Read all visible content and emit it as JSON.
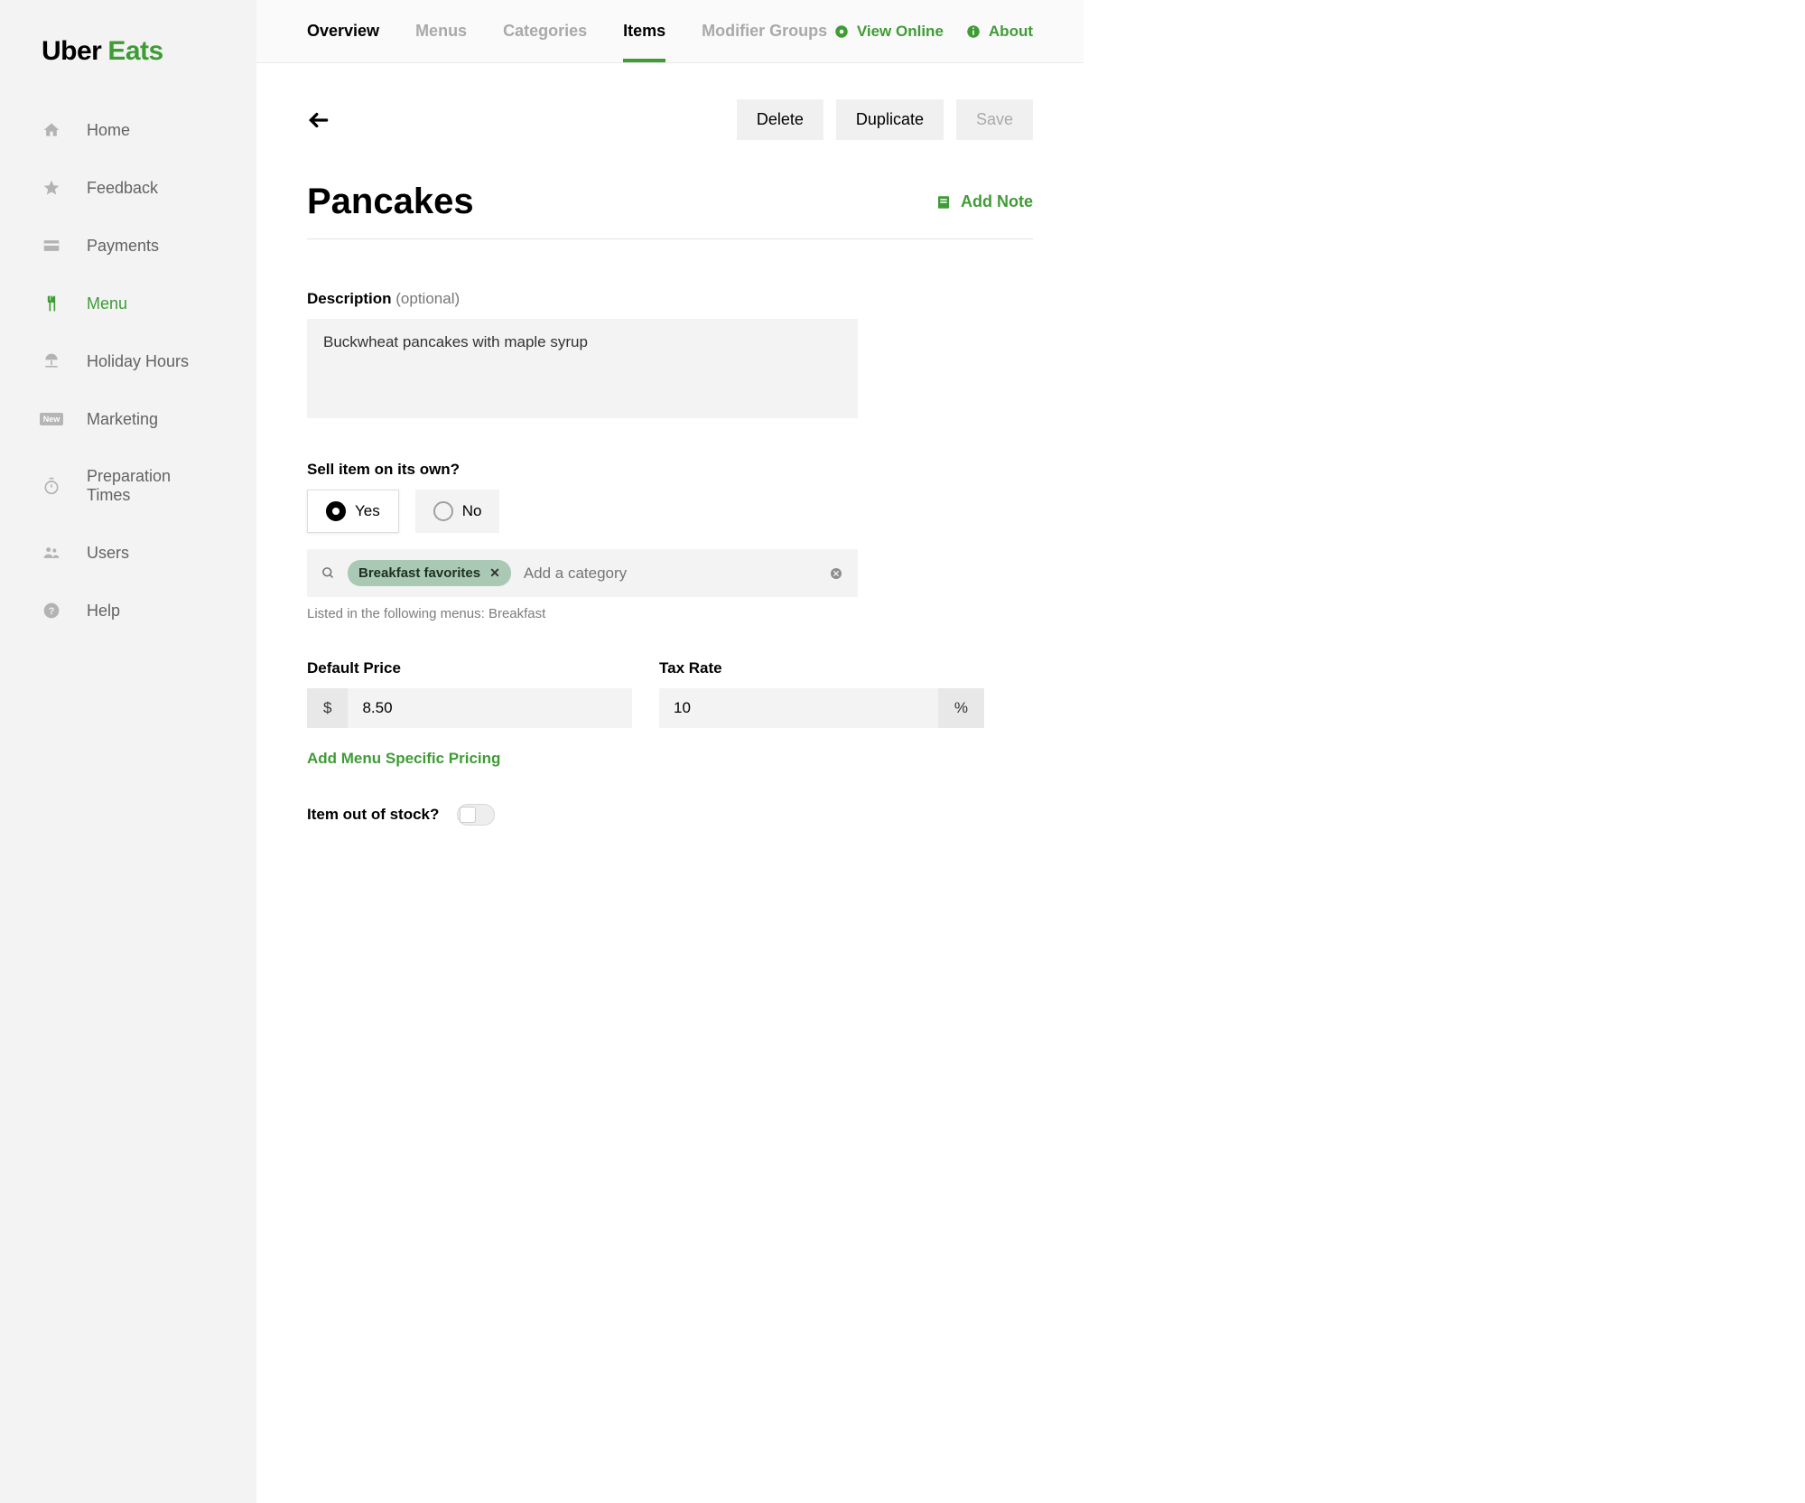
{
  "brand": {
    "part1": "Uber",
    "part2": "Eats"
  },
  "sidebar": {
    "items": [
      {
        "label": "Home"
      },
      {
        "label": "Feedback"
      },
      {
        "label": "Payments"
      },
      {
        "label": "Menu"
      },
      {
        "label": "Holiday Hours"
      },
      {
        "label": "Marketing",
        "badge": "New"
      },
      {
        "label": "Preparation Times"
      },
      {
        "label": "Users"
      },
      {
        "label": "Help"
      }
    ]
  },
  "tabs": {
    "overview": "Overview",
    "menus": "Menus",
    "categories": "Categories",
    "items": "Items",
    "modifier_groups": "Modifier Groups"
  },
  "toplinks": {
    "view_online": "View Online",
    "about": "About"
  },
  "actions": {
    "delete": "Delete",
    "duplicate": "Duplicate",
    "save": "Save",
    "add_note": "Add Note"
  },
  "item": {
    "title": "Pancakes",
    "description_label": "Description",
    "description_optional": "(optional)",
    "description_value": "Buckwheat pancakes with maple syrup",
    "sell_label": "Sell item on its own?",
    "sell_yes": "Yes",
    "sell_no": "No",
    "category_chip": "Breakfast favorites",
    "category_placeholder": "Add a category",
    "listed_text": "Listed in the following menus: Breakfast",
    "price_label": "Default Price",
    "price_currency": "$",
    "price_value": "8.50",
    "tax_label": "Tax Rate",
    "tax_value": "10",
    "tax_suffix": "%",
    "menu_specific_link": "Add Menu Specific Pricing",
    "stock_label": "Item out of stock?"
  }
}
